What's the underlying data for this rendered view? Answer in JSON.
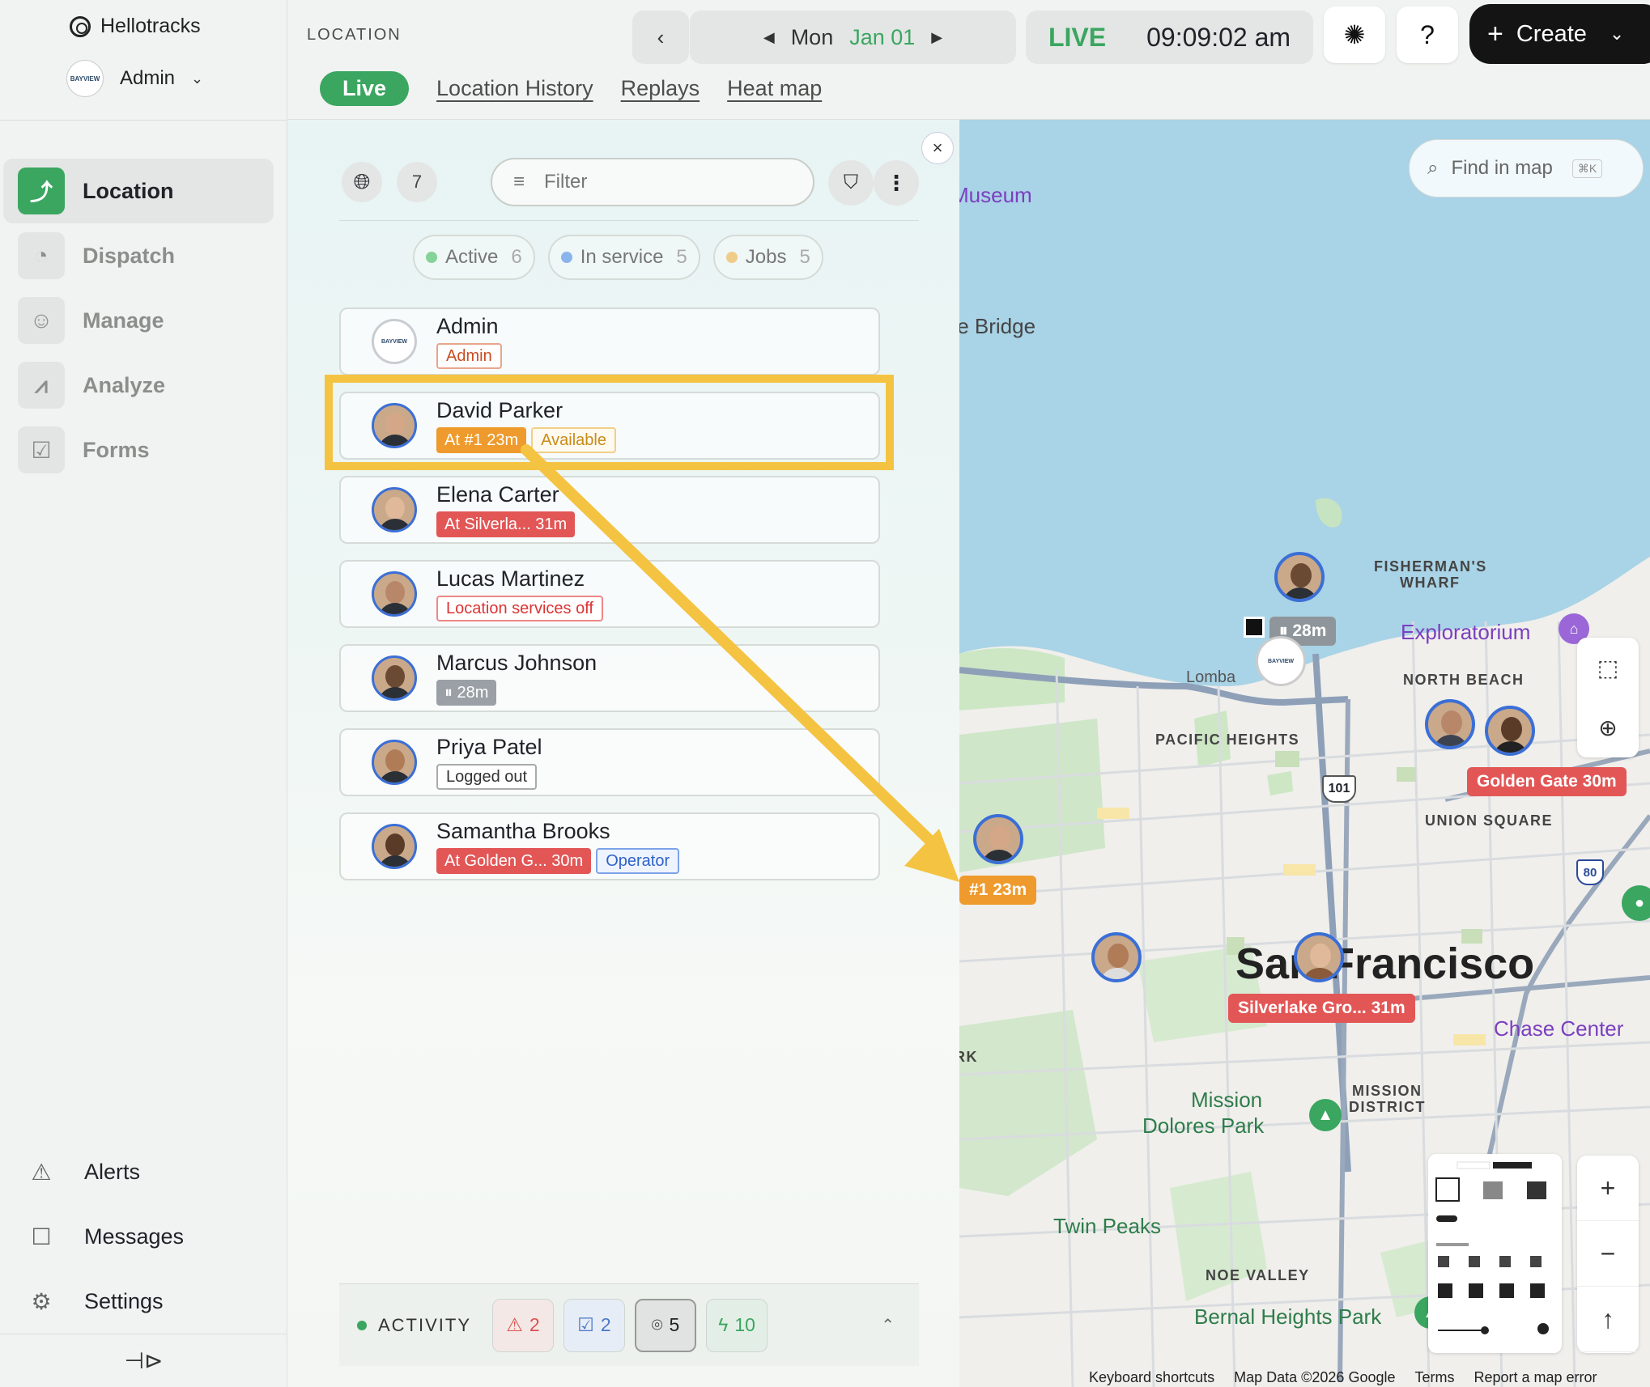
{
  "app": {
    "name": "Hellotracks",
    "account": "Admin"
  },
  "sidebar": {
    "items": [
      {
        "label": "Location",
        "icon": "route-icon"
      },
      {
        "label": "Dispatch",
        "icon": "dispatch-icon"
      },
      {
        "label": "Manage",
        "icon": "users-icon"
      },
      {
        "label": "Analyze",
        "icon": "chart-icon"
      },
      {
        "label": "Forms",
        "icon": "clipboard-icon"
      }
    ],
    "bottom": [
      {
        "label": "Alerts",
        "icon": "warning-icon"
      },
      {
        "label": "Messages",
        "icon": "chat-icon"
      },
      {
        "label": "Settings",
        "icon": "gear-icon"
      }
    ]
  },
  "header": {
    "page_label": "LOCATION",
    "tabs": [
      "Live",
      "Location History",
      "Replays",
      "Heat map"
    ],
    "day": "Mon",
    "date": "Jan 01",
    "live": "LIVE",
    "time": "09:09:02 am",
    "help": "?",
    "create": "Create"
  },
  "panel": {
    "count": "7",
    "filter_placeholder": "Filter",
    "chips": [
      {
        "label": "Active",
        "count": "6",
        "color": "#86d39a"
      },
      {
        "label": "In service",
        "count": "5",
        "color": "#8ab4ec"
      },
      {
        "label": "Jobs",
        "count": "5",
        "color": "#f0cc8a"
      }
    ],
    "people": [
      {
        "name": "Admin",
        "badges": [
          {
            "text": "Admin",
            "style": "b-admin"
          }
        ]
      },
      {
        "name": "David Parker",
        "badges": [
          {
            "text": "At #1 23m",
            "style": "b-orange"
          },
          {
            "text": "Available",
            "style": "b-avail"
          }
        ]
      },
      {
        "name": "Elena Carter",
        "badges": [
          {
            "text": "At Silverla... 31m",
            "style": "b-red"
          }
        ]
      },
      {
        "name": "Lucas Martinez",
        "badges": [
          {
            "text": "Location services off",
            "style": "b-redline"
          }
        ]
      },
      {
        "name": "Marcus Johnson",
        "badges": [
          {
            "text": "⏸ 28m",
            "style": "b-gray"
          }
        ]
      },
      {
        "name": "Priya Patel",
        "badges": [
          {
            "text": "Logged out",
            "style": "b-grayline"
          }
        ]
      },
      {
        "name": "Samantha Brooks",
        "badges": [
          {
            "text": "At Golden G... 30m",
            "style": "b-red"
          },
          {
            "text": "Operator",
            "style": "b-blue"
          }
        ]
      }
    ],
    "activity": {
      "label": "ACTIVITY",
      "alerts": "2",
      "forms": "2",
      "places": "5",
      "events": "10"
    }
  },
  "map": {
    "search_placeholder": "Find in map",
    "search_shortcut": "⌘K",
    "labels": {
      "museum": "Museum",
      "bridge": "te Bridge",
      "fishermans": "FISHERMAN'S",
      "wharf": "WHARF",
      "exploratorium": "Exploratorium",
      "north_beach": "NORTH BEACH",
      "pacific_heights": "PACIFIC HEIGHTS",
      "union_square": "UNION SQUARE",
      "lombard": "Lomba",
      "sf": "San Francisco",
      "chase": "Chase Center",
      "mission": "MISSION",
      "district": "DISTRICT",
      "mission_dolores": "Mission",
      "dolores_park": "Dolores Park",
      "twin_peaks": "Twin Peaks",
      "noe_valley": "NOE VALLEY",
      "bernal": "Bernal Heights Park",
      "rk": "RK",
      "hw101": "101",
      "hw80": "80"
    },
    "tags": {
      "david": "#1 23m",
      "marcus": "⏸ 28m",
      "samantha": "Golden Gate 30m",
      "elena": "Silverlake Gro... 31m"
    },
    "footer": [
      "Keyboard shortcuts",
      "Map Data ©2026 Google",
      "Terms",
      "Report a map error"
    ]
  }
}
